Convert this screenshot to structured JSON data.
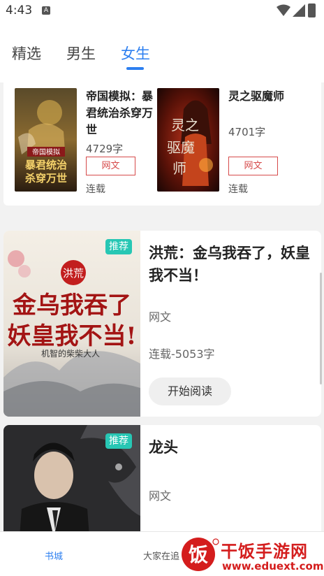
{
  "status_bar": {
    "time": "4:43",
    "notification_icon": "A"
  },
  "tabs": [
    {
      "label": "精选",
      "active": false
    },
    {
      "label": "男生",
      "active": false
    },
    {
      "label": "女生",
      "active": true
    }
  ],
  "accent_color": "#2d7ff0",
  "grid_books": [
    {
      "title": "帝国模拟：暴君统治杀穿万世",
      "words": "4729字",
      "tag": "网文",
      "status": "连载",
      "cover_text": [
        "帝国模拟",
        "暴君统治",
        "杀穿万世"
      ]
    },
    {
      "title": "灵之驱魔师",
      "words": "4701字",
      "tag": "网文",
      "status": "连载",
      "cover_text": [
        "灵之",
        "驱魔",
        "师"
      ]
    }
  ],
  "featured_books": [
    {
      "badge": "推荐",
      "title": "洪荒：金乌我吞了，妖皇我不当！",
      "genre": "网文",
      "meta": "连载-5053字",
      "read_label": "开始阅读",
      "cover_text": {
        "top": "洪荒",
        "line1": "金乌我吞了",
        "line2": "妖皇我不当!",
        "author": "机智的柴柴大人"
      }
    },
    {
      "badge": "推荐",
      "title": "龙头",
      "genre": "网文"
    }
  ],
  "bottom_nav": [
    {
      "label": "书城",
      "active": true
    },
    {
      "label": "大家在追",
      "active": false
    }
  ],
  "watermark": {
    "logo_char": "饭",
    "title": "干饭手游网",
    "url": "www.eduext.com"
  }
}
